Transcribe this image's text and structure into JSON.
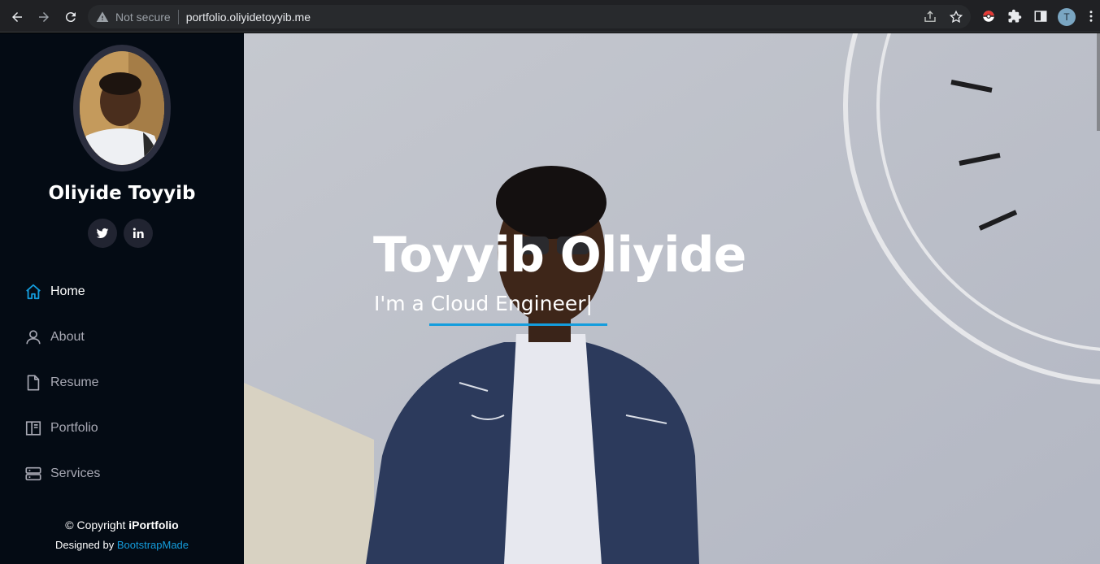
{
  "browser": {
    "security_label": "Not secure",
    "url": "portfolio.oliyidetoyyib.me",
    "profile_initial": "T",
    "icons": [
      "back-arrow-icon",
      "forward-arrow-icon",
      "reload-icon",
      "warning-icon",
      "share-icon",
      "star-icon",
      "pokeball-extension-icon",
      "puzzle-extension-icon",
      "side-panel-icon",
      "kebab-menu-icon"
    ]
  },
  "sidebar": {
    "name": "Oliyide Toyyib",
    "social": [
      {
        "label": "twitter",
        "icon": "twitter-icon"
      },
      {
        "label": "linkedin",
        "icon": "linkedin-icon"
      }
    ],
    "nav": [
      {
        "label": "Home",
        "icon": "home-icon",
        "active": true
      },
      {
        "label": "About",
        "icon": "person-icon",
        "active": false
      },
      {
        "label": "Resume",
        "icon": "file-icon",
        "active": false
      },
      {
        "label": "Portfolio",
        "icon": "book-icon",
        "active": false
      },
      {
        "label": "Services",
        "icon": "server-icon",
        "active": false
      }
    ],
    "copyright_prefix": "© Copyright ",
    "copyright_brand": "iPortfolio",
    "credits_prefix": "Designed by ",
    "credits_link": "BootstrapMade"
  },
  "hero": {
    "title": "Toyyib Oliyide",
    "tagline": "I'm a Cloud Engineer|"
  },
  "colors": {
    "accent": "#149ddd",
    "sidebar_bg": "#040b14",
    "nav_text": "#a8a9b4",
    "social_bg": "#212431"
  }
}
